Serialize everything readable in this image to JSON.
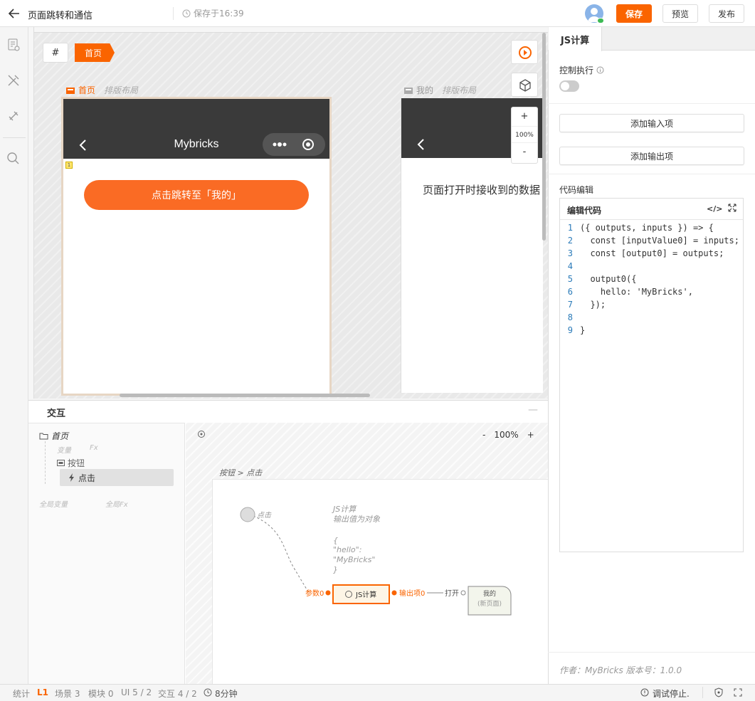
{
  "header": {
    "page_title": "页面跳转和通信",
    "save_status": "保存于16:39",
    "save_label": "保存",
    "preview_label": "预览",
    "publish_label": "发布"
  },
  "canvas": {
    "hash_label": "#",
    "home_tag": "首页",
    "page1": {
      "name": "首页",
      "layout": "排版布局",
      "nav_title": "Mybricks",
      "marker": "1",
      "button_text": "点击跳转至「我的」"
    },
    "page2": {
      "name": "我的",
      "layout": "排版布局",
      "body_text": "页面打开时接收到的数据"
    },
    "zoom_in": "+",
    "zoom_level": "100%",
    "zoom_out": "-"
  },
  "interaction": {
    "title": "交互",
    "collapse": "—",
    "tree": {
      "home": "首页",
      "var": "变量",
      "fx": "Fx",
      "button": "按钮",
      "click": "点击",
      "global_var": "全局变量",
      "global_fx": "全局Fx"
    },
    "zoom_out": "-",
    "zoom_level": "100%",
    "zoom_in": "+",
    "breadcrumb": "按钮 > 点击",
    "flow": {
      "start_label": "点击",
      "comment_lines": [
        "JS计算",
        "输出值为对象",
        "",
        "{",
        "  \"hello\":",
        "\"MyBricks\"",
        "}"
      ],
      "in_pin": "参数0",
      "node_label": "JS计算",
      "out_pin": "输出项0",
      "open_label": "打开",
      "target_line1": "我的",
      "target_line2": "(新页面)"
    }
  },
  "right_panel": {
    "tab": "JS计算",
    "control_label": "控制执行",
    "control_enabled": false,
    "add_input": "添加输入项",
    "add_output": "添加输出项",
    "code_section_label": "代码编辑",
    "code_title": "编辑代码",
    "code_lines": [
      "({ outputs, inputs }) => {",
      "  const [inputValue0] = inputs;",
      "  const [output0] = outputs;",
      "",
      "  output0({",
      "    hello: 'MyBricks',",
      "  });",
      "",
      "}"
    ],
    "footer": "作者：MyBricks    版本号：1.0.0"
  },
  "status_bar": {
    "stats": "统计",
    "level": "L1",
    "scenes": "场景 3",
    "modules": "模块 0",
    "ui": "UI 5 / 2",
    "interactions": "交互 4 / 2",
    "time": "8分钟",
    "debug": "调试停止."
  },
  "colors": {
    "accent": "#fa6400",
    "nav_bg": "#3a3a3a"
  }
}
